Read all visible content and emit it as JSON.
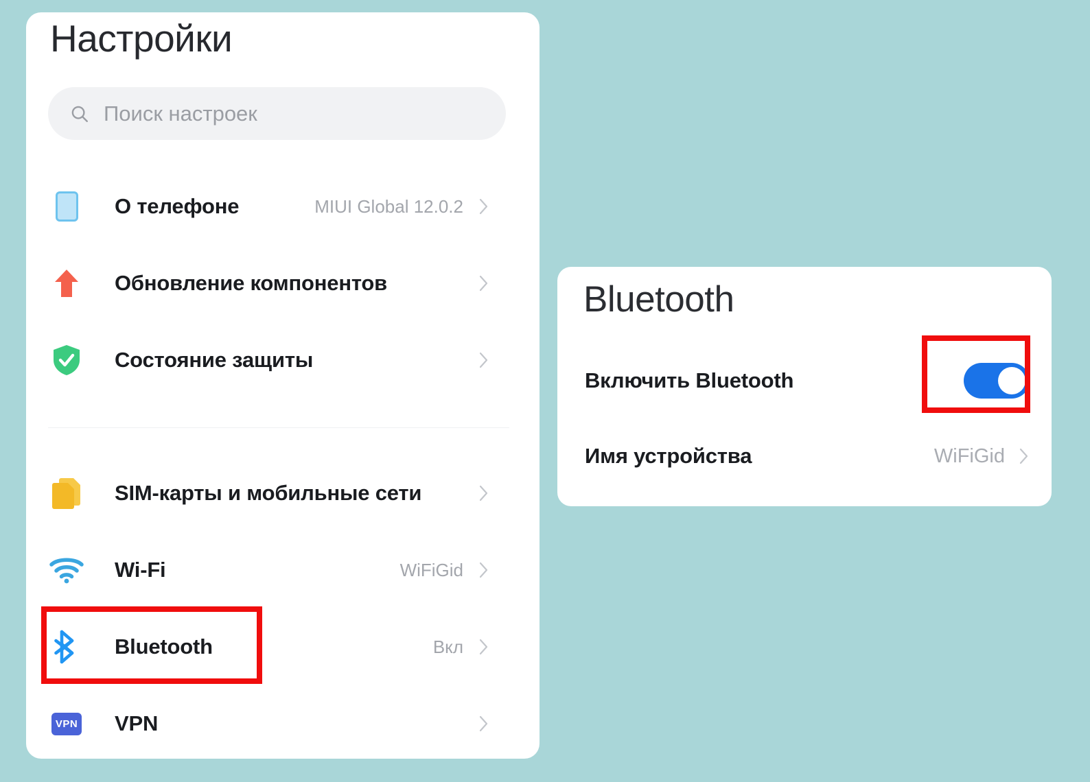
{
  "theme": {
    "background": "#a9d6d8",
    "card_background": "#ffffff",
    "highlight_border": "#f00d0d",
    "toggle_on": "#1a73e8",
    "label_color": "#1a1c20",
    "value_color": "#a3a6ac"
  },
  "settings": {
    "title": "Настройки",
    "search": {
      "placeholder": "Поиск настроек",
      "value": "",
      "icon": "search-icon"
    },
    "groups": [
      {
        "name": "system",
        "rows": [
          {
            "icon": "phone-icon",
            "label": "О телефоне",
            "value": "MIUI Global 12.0.2",
            "chevron": true
          },
          {
            "icon": "arrow-up-icon",
            "label": "Обновление компонентов",
            "value": "",
            "chevron": true
          },
          {
            "icon": "shield-check-icon",
            "label": "Состояние защиты",
            "value": "",
            "chevron": true
          }
        ]
      },
      {
        "name": "network",
        "rows": [
          {
            "icon": "sim-card-icon",
            "label": "SIM-карты и мобильные сети",
            "value": "",
            "chevron": true
          },
          {
            "icon": "wifi-icon",
            "label": "Wi-Fi",
            "value": "WiFiGid",
            "chevron": true
          },
          {
            "icon": "bluetooth-icon",
            "label": "Bluetooth",
            "value": "Вкл",
            "chevron": true
          },
          {
            "icon": "vpn-icon",
            "label": "VPN",
            "value": "",
            "chevron": true
          }
        ]
      }
    ]
  },
  "bluetooth_panel": {
    "title": "Bluetooth",
    "rows": [
      {
        "label": "Включить Bluetooth",
        "control": "toggle",
        "toggle_on": true,
        "value": ""
      },
      {
        "label": "Имя устройства",
        "control": "value",
        "value": "WiFiGid",
        "chevron": true
      }
    ]
  },
  "annotations": [
    {
      "name": "bluetooth-row-highlight",
      "target": "Bluetooth list row",
      "color": "#f00d0d"
    },
    {
      "name": "bluetooth-toggle-highlight",
      "target": "Включить Bluetooth toggle",
      "color": "#f00d0d"
    }
  ],
  "icons": {
    "vpn_text": "VPN"
  }
}
